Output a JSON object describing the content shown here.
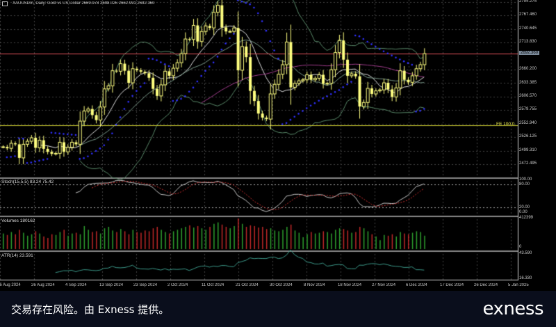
{
  "header": {
    "title": "XAUUSDm, Daily:  Gold vs US Dollar  2669.978 2698.026 2662.991 2692.360"
  },
  "panels": {
    "stoch": "Stoch(15,5,5) 83.24 75.42",
    "volumes": "Volumes 180162",
    "atr": "ATR(14) 23.591",
    "fe": "FE 100.0"
  },
  "footer": {
    "disclaimer": "交易存在风险。由 Exness 提供。",
    "logo": "exness"
  },
  "colors": {
    "bull": "#ffff80",
    "bear": "#ffff80",
    "price_line": "#e0505a",
    "fe_line": "#c8c832",
    "bands": "#5a8a6a",
    "ma_fast": "#e0e0e0",
    "ma_slow": "#a03c8c",
    "sar": "#3030ff",
    "vol_up": "#2ea02e",
    "vol_down": "#c02828",
    "atr": "#3c9a8a"
  },
  "chart_data": {
    "type": "candlestick",
    "symbol": "XAUUSDm",
    "timeframe": "Daily",
    "ylim": [
      2460,
      2800
    ],
    "y_ticks": [
      "2794.275",
      "2767.460",
      "2740.645",
      "2713.830",
      "2660.200",
      "2633.385",
      "2606.570",
      "2579.755",
      "2552.940",
      "2526.125",
      "2499.310",
      "2472.495"
    ],
    "current_price": 2692.36,
    "current_price_label": "2692.360",
    "fe_level": 2549.5,
    "x_ticks": [
      "16 Aug 2024",
      "26 Aug 2024",
      "4 Sep 2024",
      "13 Sep 2024",
      "23 Sep 2024",
      "2 Oct 2024",
      "11 Oct 2024",
      "21 Oct 2024",
      "30 Oct 2024",
      "8 Nov 2024",
      "18 Nov 2024",
      "27 Nov 2024",
      "6 Dec 2024",
      "17 Dec 2024",
      "26 Dec 2024",
      "5 Jan 2025"
    ],
    "closes": [
      2507,
      2504,
      2514,
      2512,
      2485,
      2512,
      2518,
      2525,
      2505,
      2520,
      2503,
      2497,
      2493,
      2494,
      2516,
      2497,
      2506,
      2516,
      2512,
      2558,
      2578,
      2582,
      2570,
      2560,
      2586,
      2622,
      2628,
      2658,
      2657,
      2672,
      2658,
      2634,
      2662,
      2659,
      2656,
      2653,
      2644,
      2622,
      2608,
      2630,
      2657,
      2648,
      2663,
      2674,
      2692,
      2721,
      2720,
      2748,
      2716,
      2736,
      2747,
      2743,
      2774,
      2788,
      2744,
      2736,
      2736,
      2743,
      2659,
      2706,
      2685,
      2618,
      2598,
      2573,
      2565,
      2562,
      2612,
      2631,
      2651,
      2670,
      2715,
      2625,
      2633,
      2638,
      2640,
      2650,
      2640,
      2643,
      2650,
      2632,
      2633,
      2660,
      2694,
      2718,
      2680,
      2648,
      2652,
      2647,
      2587,
      2595,
      2623,
      2612,
      2618,
      2620,
      2634,
      2621,
      2606,
      2624,
      2658,
      2640,
      2635,
      2648,
      2662,
      2670,
      2692
    ],
    "volumes": [
      210000,
      190000,
      230000,
      200000,
      260000,
      220000,
      180000,
      200000,
      240000,
      210000,
      170000,
      150000,
      200000,
      190000,
      230000,
      260000,
      180000,
      210000,
      220000,
      200000,
      310000,
      260000,
      230000,
      240000,
      210000,
      280000,
      300000,
      250000,
      230000,
      270000,
      240000,
      200000,
      260000,
      230000,
      220000,
      250000,
      240000,
      280000,
      300000,
      260000,
      230000,
      210000,
      240000,
      260000,
      280000,
      300000,
      320000,
      290000,
      310000,
      280000,
      260000,
      300000,
      340000,
      360000,
      330000,
      300000,
      280000,
      310000,
      412399,
      340000,
      300000,
      320000,
      310000,
      290000,
      300000,
      270000,
      280000,
      250000,
      240000,
      260000,
      300000,
      330000,
      250000,
      220000,
      160000,
      200000,
      230000,
      210000,
      220000,
      240000,
      230000,
      210000,
      260000,
      280000,
      270000,
      250000,
      220000,
      230000,
      300000,
      280000,
      240000,
      200000,
      170000,
      120000,
      190000,
      180000,
      200000,
      170000,
      230000,
      210000,
      200000,
      220000,
      240000,
      230000,
      180162
    ],
    "stoch_levels": [
      80,
      20
    ],
    "stoch_ylim": [
      0,
      100
    ],
    "volume_max": 412399,
    "atr_ylim": [
      16.33,
      43.59
    ]
  }
}
